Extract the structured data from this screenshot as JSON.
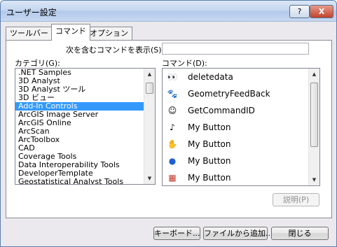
{
  "window": {
    "title": "ユーザー設定",
    "help_label": "?",
    "close_label": "X"
  },
  "tabs": [
    {
      "label": "ツールバー"
    },
    {
      "label": "コマンド"
    },
    {
      "label": "オプション"
    }
  ],
  "filter": {
    "label": "次を含むコマンドを表示(S):",
    "value": ""
  },
  "categories": {
    "label": "カテゴリ(G):",
    "selected": "Add-In Controls",
    "items": [
      ".NET Samples",
      "3D Analyst",
      "3D Analyst ツール",
      "3D ビュー",
      "Add-In Controls",
      "ArcGIS Image Server",
      "ArcGIS Online",
      "ArcScan",
      "ArcToolbox",
      "CAD",
      "Coverage Tools",
      "Data Interoperability Tools",
      "DeveloperTemplate",
      "Geostatistical Analyst Tools"
    ]
  },
  "commands": {
    "label": "コマンド(D):",
    "items": [
      {
        "label": "deletedata",
        "icon": "binoculars-icon"
      },
      {
        "label": "GeometryFeedBack",
        "icon": "paw-icon"
      },
      {
        "label": "GetCommandID",
        "icon": "smiley-icon"
      },
      {
        "label": "My Button",
        "icon": "music-note-icon"
      },
      {
        "label": "My Button",
        "icon": "handshake-icon"
      },
      {
        "label": "My Button",
        "icon": "blue-sphere-icon"
      },
      {
        "label": "My Button",
        "icon": "rubiks-cube-icon"
      }
    ]
  },
  "buttons": {
    "describe": "説明(P)",
    "keyboard": "キーボード...",
    "add_from_file": "ファイルから追加...",
    "close": "閉じる"
  },
  "colors": {
    "selection": "#3399ff",
    "title_gradient_top": "#dbe7f7"
  }
}
